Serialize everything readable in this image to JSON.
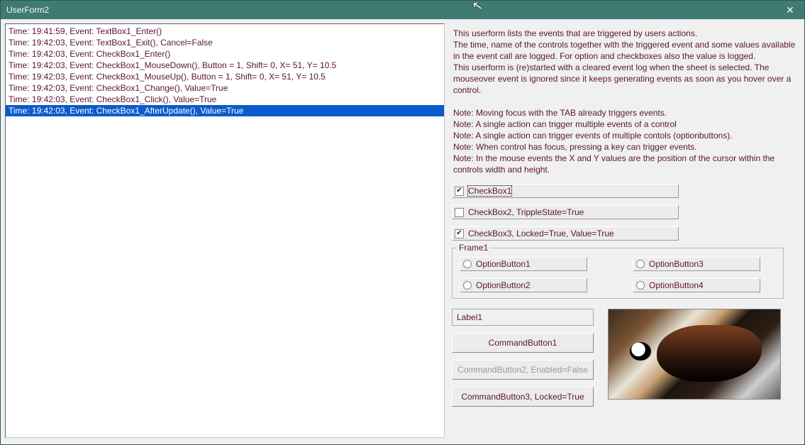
{
  "window": {
    "title": "UserForm2"
  },
  "log": {
    "items": [
      "Time: 19:41:59, Event: TextBox1_Enter()",
      "Time: 19:42:03, Event: TextBox1_Exit(), Cancel=False",
      "Time: 19:42:03, Event: CheckBox1_Enter()",
      "Time: 19:42:03, Event: CheckBox1_MouseDown(), Button =  1, Shift= 0, X= 51, Y= 10.5",
      "Time: 19:42:03, Event: CheckBox1_MouseUp(), Button =  1, Shift= 0, X= 51, Y= 10.5",
      "Time: 19:42:03, Event: CheckBox1_Change(), Value=True",
      "Time: 19:42:03, Event: CheckBox1_Click(), Value=True",
      "Time: 19:42:03, Event: CheckBox1_AfterUpdate(), Value=True"
    ],
    "selected_index": 7
  },
  "info": {
    "p1": "This userform lists the events that are triggered by users actions.",
    "p2": "The time, name of the controls together with the triggered event and some values available in the event call are logged. For option and checkboxes also the value is logged.",
    "p3": "This userform is (re)started with a cleared event log when the sheet is selected. The mouseover event is ignored since it keeps generating events as soon as you hover over a control.",
    "n1": "Note: Moving focus with the TAB already triggers events.",
    "n2": "Note: A single action can trigger multiple events of a control",
    "n3": "Note: A single action can trigger events of multiple contols (optionbuttons).",
    "n4": "Note: When control has focus, pressing a key can trigger events.",
    "n5": "Note: In the mouse events the X and Y values are the position of the cursor within the controls width and height."
  },
  "checks": {
    "c1": {
      "label": "CheckBox1",
      "checked": true,
      "focused": true
    },
    "c2": {
      "label": "CheckBox2, TrippleState=True",
      "checked": false,
      "focused": false
    },
    "c3": {
      "label": "CheckBox3, Locked=True, Value=True",
      "checked": true,
      "focused": false
    }
  },
  "frame": {
    "legend": "Frame1",
    "o1": "OptionButton1",
    "o2": "OptionButton2",
    "o3": "OptionButton3",
    "o4": "OptionButton4"
  },
  "label1": "Label1",
  "buttons": {
    "b1": "CommandButton1",
    "b2": "CommandButton2, Enabled=False",
    "b3": "CommandButton3, Locked=True"
  }
}
